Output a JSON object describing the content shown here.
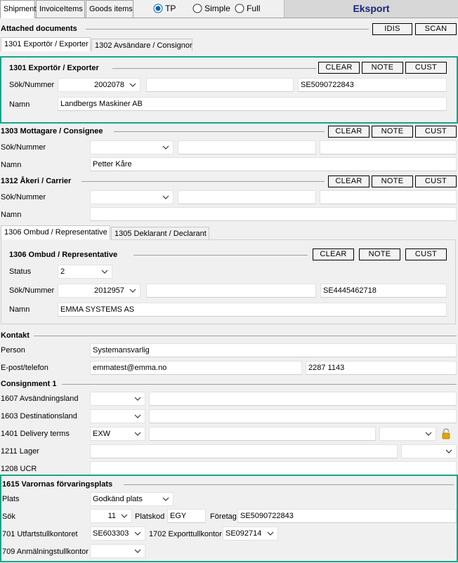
{
  "tabs": [
    "Shipment",
    "InvoiceItems",
    "Goods items"
  ],
  "modes": {
    "tp": "TP",
    "simple": "Simple",
    "full": "Full",
    "selected": "tp"
  },
  "eksport": "Eksport",
  "attached": {
    "title": "Attached documents",
    "idis": "IDIS",
    "scan": "SCAN"
  },
  "party_tabs": [
    "1301 Exportör / Exporter",
    "1302 Avsändare / Consignor"
  ],
  "exporter": {
    "title": "1301 Exportör / Exporter",
    "clear": "CLEAR",
    "note": "NOTE",
    "cust": "CUST",
    "sok_label": "Sök/Nummer",
    "sok_value": "2002078",
    "middle": "",
    "id": "SE5090722843",
    "namn_label": "Namn",
    "namn": "Landbergs Maskiner AB"
  },
  "consignee": {
    "title": "1303 Mottagare / Consignee",
    "clear": "CLEAR",
    "note": "NOTE",
    "cust": "CUST",
    "sok_label": "Sök/Nummer",
    "sok_value": "",
    "middle": "",
    "id": "",
    "namn_label": "Namn",
    "namn": "Petter Kåre"
  },
  "carrier": {
    "title": "1312 Åkeri / Carrier",
    "clear": "CLEAR",
    "note": "NOTE",
    "cust": "CUST",
    "sok_label": "Sök/Nummer",
    "sok_value": "",
    "middle": "",
    "id": "",
    "namn_label": "Namn",
    "namn": ""
  },
  "rep_tabs": [
    "1306 Ombud / Representative",
    "1305 Deklarant / Declarant"
  ],
  "representative": {
    "title": "1306 Ombud / Representative",
    "clear": "CLEAR",
    "note": "NOTE",
    "cust": "CUST",
    "status_label": "Status",
    "status": "2",
    "sok_label": "Sök/Nummer",
    "sok_value": "2012957",
    "middle": "",
    "id": "SE4445462718",
    "namn_label": "Namn",
    "namn": "EMMA SYSTEMS AS"
  },
  "kontakt": {
    "title": "Kontakt",
    "person_label": "Person",
    "person": "Systemansvarlig",
    "epost_label": "E-post/telefon",
    "email": "emmatest@emma.no",
    "phone": "2287 1143"
  },
  "consignment": {
    "title": "Consignment 1",
    "avs_label": "1607 Avsändningsland",
    "dest_label": "1603 Destinationsland",
    "delivery_label": "1401 Delivery terms",
    "delivery": "EXW",
    "lager_label": "1211 Lager",
    "ucr_label": "1208 UCR"
  },
  "storage": {
    "title": "1615 Varornas förvaringsplats",
    "plats_label": "Plats",
    "plats": "Godkänd plats",
    "sok_label": "Sök",
    "sok": "11",
    "platskod_label": "Platskod",
    "platskod": "EGY",
    "foretag_label": "Företag",
    "foretag": "SE5090722843",
    "utf_label": "701 Utfartstullkontoret",
    "utf": "SE603303",
    "exp_label": "1702 Exporttullkontor",
    "exp": "SE092714",
    "anm_label": "709 Anmälningstullkontor",
    "anm": ""
  },
  "colors": {
    "teal": "#17a589",
    "eksport_text": "#1a237e",
    "lock": "#e0a500"
  }
}
